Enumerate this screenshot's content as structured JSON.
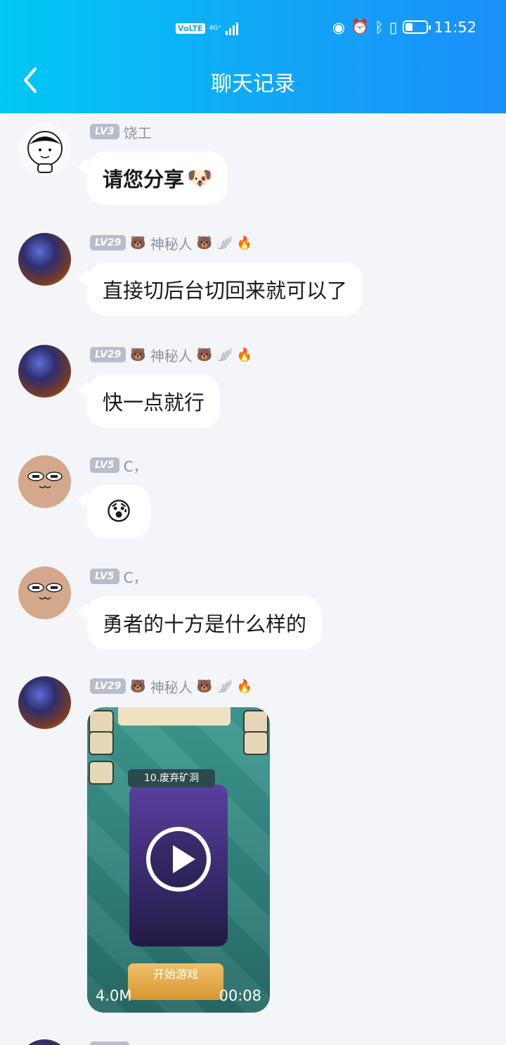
{
  "status_bar": {
    "volte": "VoLTE",
    "network": "4G⁺",
    "time": "11:52"
  },
  "nav": {
    "title": "聊天记录"
  },
  "messages": [
    {
      "level": "LV3",
      "name": "饶工",
      "text": "请您分享"
    },
    {
      "level": "LV29",
      "name": "神秘人",
      "text": "直接切后台切回来就可以了"
    },
    {
      "level": "LV29",
      "name": "神秘人",
      "text": "快一点就行"
    },
    {
      "level": "LV5",
      "name": "C，",
      "emoji": "😰"
    },
    {
      "level": "LV5",
      "name": "C，",
      "text": "勇者的十方是什么样的"
    },
    {
      "level": "LV29",
      "name": "神秘人",
      "video": {
        "stage": "10.废弃矿洞",
        "start_label": "开始游戏",
        "size": "4.0M",
        "duration": "00:08"
      }
    }
  ],
  "colors": {
    "header_start": "#00c8f4",
    "header_end": "#1a8ff9",
    "background": "#f4f5f9",
    "level_badge": "#b8bccb"
  }
}
